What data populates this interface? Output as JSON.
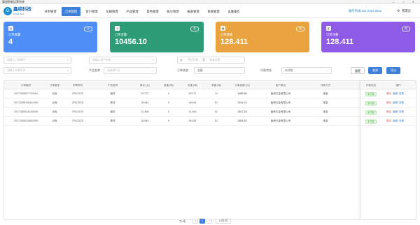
{
  "window": {
    "title": "渠道智能运营系统",
    "controls": "— □ ✕"
  },
  "logo": {
    "mark": "G",
    "name": "鑫缔科技",
    "sub": "Xinndi Tech"
  },
  "nav": {
    "menu": [
      "开单管理",
      "订单管理",
      "客户管理",
      "车辆管理",
      "产品管理",
      "角色管理",
      "账号管理",
      "报表管理",
      "系统管理",
      "设置操作"
    ],
    "active_index": 1,
    "hotline": "服务热线:151 2161 5632",
    "user": "管理员"
  },
  "cards": [
    {
      "label": "订单数量",
      "value": "4",
      "tag": "今",
      "icon": "doc-icon",
      "color": "#4f8ef7"
    },
    {
      "label": "订单金额",
      "value": "10456.10",
      "tag": "总",
      "icon": "money-icon",
      "color": "#2f9c78"
    },
    {
      "label": "订单重量",
      "value": "128.411",
      "tag": "吨",
      "icon": "weight-icon",
      "color": "#e9a33f"
    },
    {
      "label": "订单净重",
      "value": "128.411",
      "tag": "吨",
      "icon": "net-icon",
      "color": "#8e5be6"
    }
  ],
  "filters": {
    "order_no_placeholder": "请输入订单编号",
    "customer_placeholder": "请输入客户名称",
    "start_placeholder": "开始日期",
    "date_sep": "至",
    "end_placeholder": "结束日期",
    "plate_placeholder": "请输入车牌号码",
    "product_label": "产品名称",
    "product_placeholder": "请选择产品",
    "order_status_label": "订单状态",
    "order_status_value": "全部",
    "pay_status_label": "付款状态",
    "pay_status_value": "未付款",
    "reset": "重置",
    "query": "查询",
    "export": "导出"
  },
  "table": {
    "headers": [
      "订单编号",
      "订单类型",
      "车牌号码",
      "产品名称",
      "单价 (元)",
      "皮重 (吨)",
      "毛重 (吨)",
      "净重 (吨)",
      "订单金额 (元)",
      "客户单位",
      "付款方式",
      "付款状态",
      "操作"
    ],
    "rows": [
      [
        "20171508317704004",
        "出库",
        "沪A12578",
        "钢材",
        "20.737",
        "0",
        "20.737",
        "10",
        "1966.58",
        "鑫缔五金有限公司",
        "现金",
        "未付款"
      ],
      [
        "20171508316411009",
        "出库",
        "沪A12578",
        "铁材",
        "38.844",
        "0",
        "38.844",
        "81",
        "3314.74",
        "鑫缔五金有限公司",
        "现金",
        "未付款"
      ],
      [
        "20171508316154009",
        "出库",
        "沪A12578",
        "钢材",
        "31.466",
        "0",
        "31.466",
        "81",
        "2517.28",
        "鑫缔五金有限公司",
        "现金",
        "未付款"
      ],
      [
        "20171508316451009",
        "出库",
        "沪A12578",
        "铁材",
        "38.844",
        "0",
        "38.844",
        "81",
        "2651.62",
        "鑫缔五金有限公司",
        "现金",
        "未付款"
      ]
    ],
    "actions": [
      "删除",
      "编辑",
      "查看"
    ]
  },
  "pager": {
    "total": "共4条",
    "prev": "‹",
    "page": "1",
    "next": "›",
    "size": "10条/页"
  }
}
